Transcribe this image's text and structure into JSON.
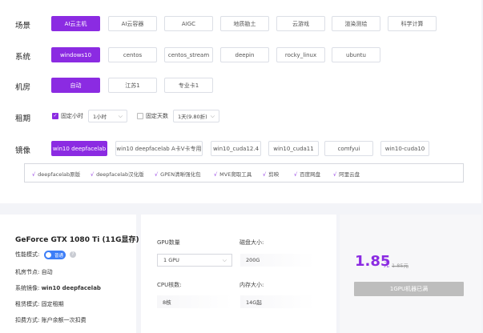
{
  "rows": {
    "scene": {
      "label": "场景",
      "options": [
        "AI云主机",
        "AI云容器",
        "AIGC",
        "地质勘土",
        "云游戏",
        "渲染测绘",
        "科学计算"
      ],
      "selected": "AI云主机"
    },
    "os": {
      "label": "系统",
      "options": [
        "windows10",
        "centos",
        "centos_stream",
        "deepin",
        "rocky_linux",
        "ubuntu"
      ],
      "selected": "windows10"
    },
    "room": {
      "label": "机房",
      "options": [
        "自动",
        "江苏1",
        "专业卡1"
      ],
      "selected": "自动"
    },
    "rent": {
      "label": "租期",
      "fixed_hours_label": "固定小时",
      "fixed_hours_checked": true,
      "hours_value": "1小时",
      "fixed_days_label": "固定天数",
      "fixed_days_checked": false,
      "days_value": "1天(9.80折)"
    },
    "image": {
      "label": "镜像",
      "options": [
        "win10 deepfacelab",
        "win10 deepfacelab A卡V卡专用",
        "win10_cuda12.4",
        "win10_cuda11",
        "comfyui",
        "win10-cuda10"
      ],
      "selected": "win10 deepfacelab"
    }
  },
  "tools": [
    "deepfacelab原版",
    "deepfacelab汉化版",
    "GPEN清晰强化包",
    "MVE爬取工具",
    "剪映",
    "百度网盘",
    "阿里云盘"
  ],
  "tool_tick": "√",
  "card": {
    "gpu_name": "GeForce GTX 1080 Ti (11G显存)",
    "perf_mode_label": "性能模式:",
    "perf_mode_value": "普通",
    "help_glyph": "?",
    "node_label": "机房节点:",
    "node_value": "自动",
    "image_label": "系统镜像:",
    "image_value": "win10 deepfacelab",
    "rent_mode_label": "租赁模式:",
    "rent_mode_value": "固定租期",
    "billing_label": "扣费方式:",
    "billing_value": "账户余额一次扣费"
  },
  "specs": {
    "gpu_count_label": "GPU数量",
    "gpu_count_value": "1 GPU",
    "disk_label": "磁盘大小:",
    "disk_value": "200G",
    "cpu_label": "CPU核数:",
    "cpu_value": "8核",
    "mem_label": "内存大小:",
    "mem_value": "14G起"
  },
  "pricing": {
    "price": "1.85",
    "unit": "元",
    "old_price": "1.85元",
    "button": "1GPU机器已满"
  },
  "icons": {
    "caret": "chevron-down-icon",
    "check": "checkmark-icon",
    "help": "question-icon"
  },
  "colors": {
    "accent": "#8b2be2",
    "toggle": "#3d7ef7",
    "disabled_button": "#bdbdbd"
  }
}
